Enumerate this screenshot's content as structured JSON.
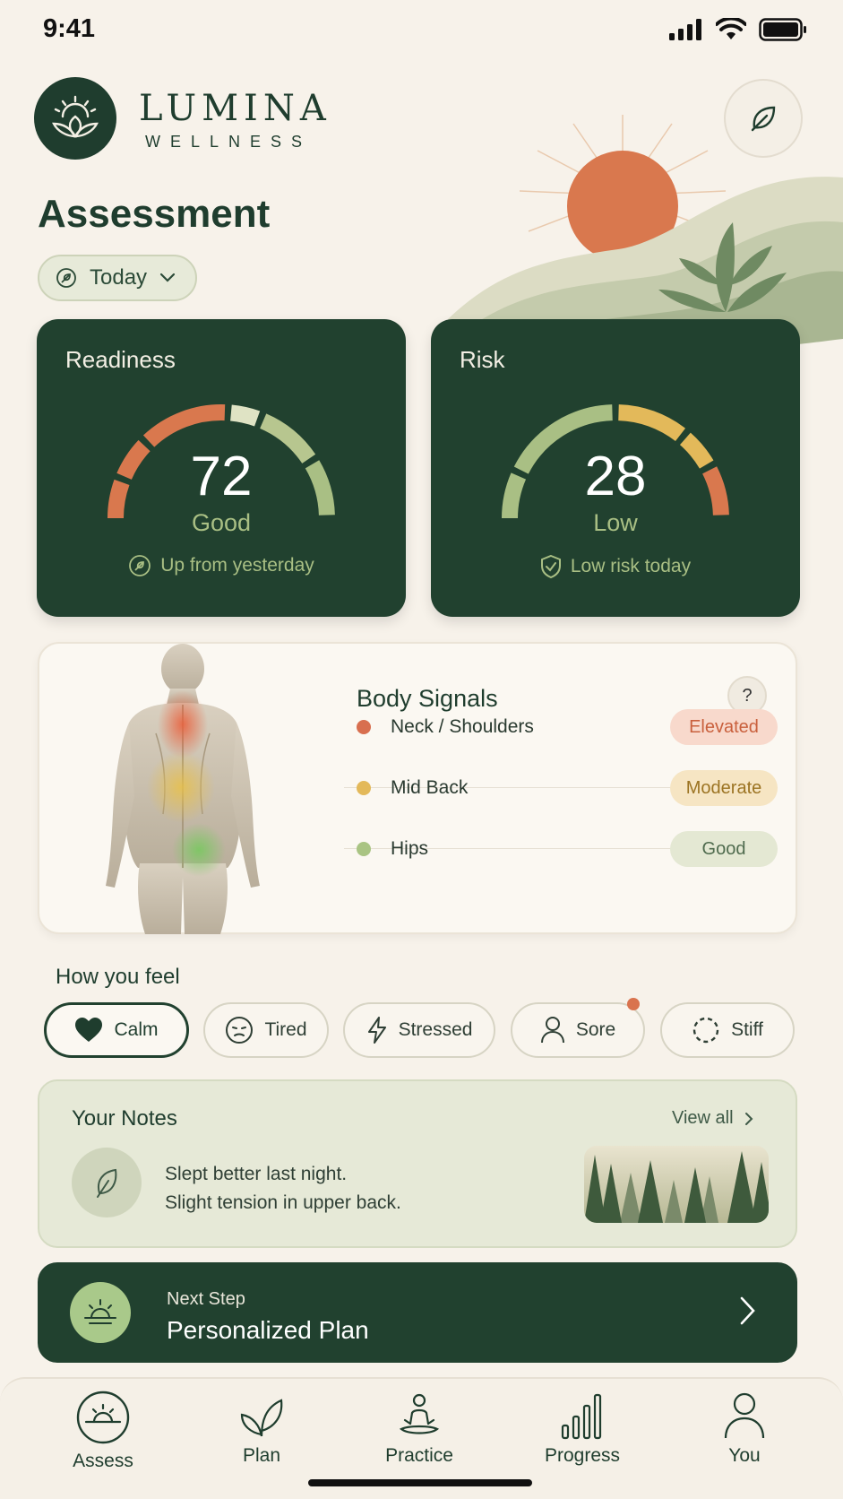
{
  "status": {
    "time": "9:41"
  },
  "brand": {
    "name": "LUMINA",
    "sub": "WELLNESS"
  },
  "page": {
    "title": "Assessment",
    "date_filter": "Today"
  },
  "readiness": {
    "label": "Readiness",
    "value": "72",
    "status": "Good",
    "note": "Up from yesterday",
    "score": 72
  },
  "risk": {
    "label": "Risk",
    "value": "28",
    "status": "Low",
    "note": "Low risk today",
    "score": 28
  },
  "body_signals": {
    "title": "Body Signals",
    "help": "?",
    "items": [
      {
        "name": "Neck / Shoulders",
        "status": "Elevated"
      },
      {
        "name": "Mid Back",
        "status": "Moderate"
      },
      {
        "name": "Hips",
        "status": "Good"
      }
    ]
  },
  "feel": {
    "title": "How you feel",
    "options": [
      {
        "label": "Calm",
        "selected": true
      },
      {
        "label": "Tired",
        "selected": false
      },
      {
        "label": "Stressed",
        "selected": false
      },
      {
        "label": "Sore",
        "selected": false
      },
      {
        "label": "Stiff",
        "selected": false
      }
    ]
  },
  "notes": {
    "title": "Your Notes",
    "view_all": "View all",
    "line1": "Slept better last night.",
    "line2": "Slight tension in upper back."
  },
  "next_step": {
    "kicker": "Next Step",
    "title": "Personalized Plan"
  },
  "tabs": [
    {
      "label": "Assess",
      "icon": "sunrise-icon"
    },
    {
      "label": "Plan",
      "icon": "leaf-icon"
    },
    {
      "label": "Practice",
      "icon": "meditation-icon"
    },
    {
      "label": "Progress",
      "icon": "bars-icon"
    },
    {
      "label": "You",
      "icon": "user-icon"
    }
  ],
  "colors": {
    "accent": "#21412f",
    "background": "#f7f2ea",
    "elevated": "#d9734e",
    "moderate": "#e3b95a",
    "good": "#a9bf84"
  }
}
